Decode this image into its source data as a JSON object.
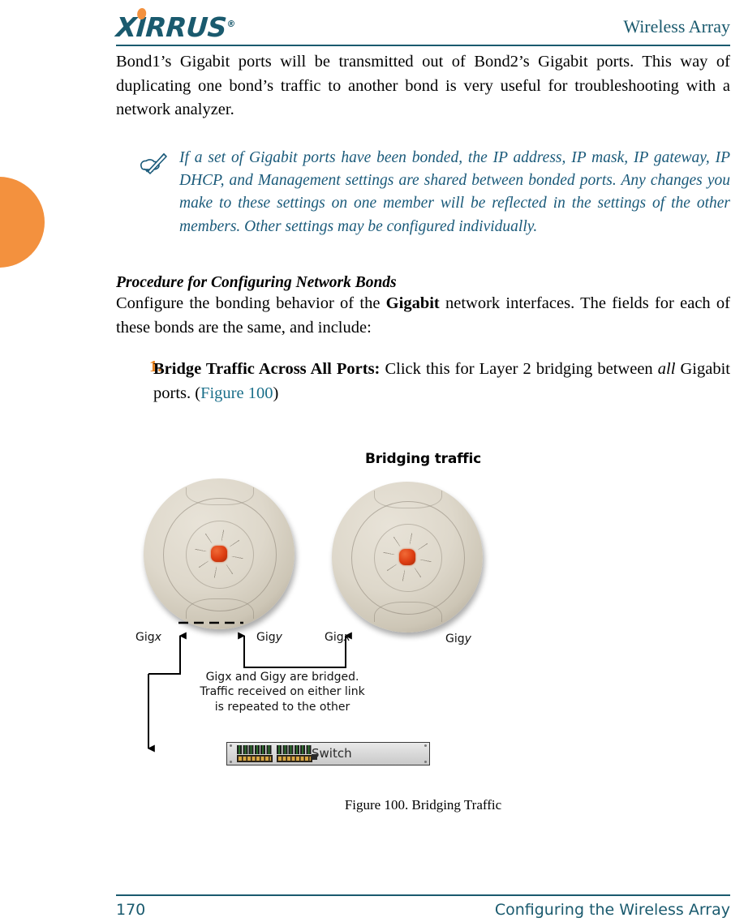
{
  "header": {
    "logo_text": "XIRRUS",
    "logo_registered": "®",
    "title": "Wireless Array"
  },
  "body": {
    "paragraph_1": "Bond1’s Gigabit ports will be transmitted out of Bond2’s Gigabit ports. This way of duplicating one bond’s traffic to another bond is very useful for troubleshooting with a network analyzer.",
    "note": "If a set of Gigabit ports have been bonded, the IP address, IP mask, IP gateway, IP DHCP, and Management settings are shared between bonded ports. Any changes you make to these settings on one member will be reflected in the settings of the other members. Other settings may be configured individually.",
    "note_icon": "note-pen-hand-icon",
    "section_heading": "Procedure for Configuring Network Bonds",
    "paragraph_2_part1": "Configure the bonding behavior of the ",
    "paragraph_2_bold": "Gigabit",
    "paragraph_2_part2": " network interfaces. The fields for each of these bonds are the same, and include:",
    "list": [
      {
        "number": "1.",
        "bold_lead": "Bridge Traffic Across All Ports:",
        "text_1": " Click this for Layer 2 bridging between ",
        "italic": "all",
        "text_2": " Gigabit ports. (",
        "xref": "Figure 100",
        "text_3": ")"
      }
    ]
  },
  "figure": {
    "title": "Bridging traffic",
    "caption": "Figure 100. Bridging Traffic",
    "arrays": [
      {
        "name": "array-left",
        "port_left": "Gig",
        "port_left_var": "x",
        "port_right": "Gig",
        "port_right_var": "y"
      },
      {
        "name": "array-right",
        "port_left": "Gig",
        "port_left_var": "x",
        "port_right": "Gig",
        "port_right_var": "y"
      }
    ],
    "labels": {
      "left_array_gigx": "Gig",
      "left_array_gigx_var": "x",
      "left_array_gigy": "Gig",
      "left_array_gigy_var": "y",
      "right_array_gigx": "Gig",
      "right_array_gigx_var": "x",
      "right_array_gigy": "Gig",
      "right_array_gigy_var": "y"
    },
    "annotation_line_1": "Gigx and Gigy are bridged.",
    "annotation_line_2": "Traffic received on either link",
    "annotation_line_3": "is repeated to the other",
    "switch_label": "Switch"
  },
  "footer": {
    "page_number": "170",
    "section_title": "Configuring the Wireless Array"
  },
  "colors": {
    "brand_teal": "#1a5a6e",
    "brand_orange": "#f3913e",
    "note_text": "#1a5a7a",
    "xref_link": "#1a6f8a",
    "list_number": "#e8821e"
  }
}
